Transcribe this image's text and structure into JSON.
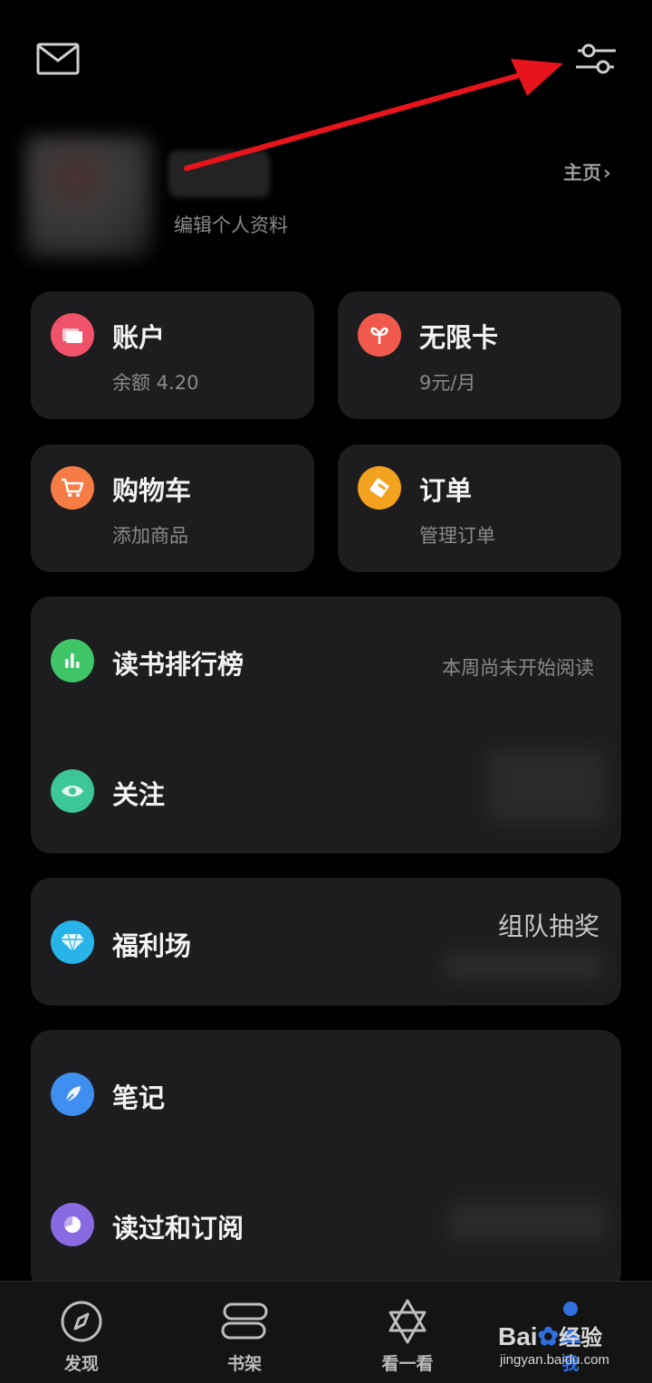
{
  "header": {
    "mail_icon": "mail-icon",
    "settings_icon": "sliders-icon"
  },
  "profile": {
    "edit_label": "编辑个人资料",
    "home_label": "主页",
    "home_arrow": "›"
  },
  "tiles": [
    {
      "title": "账户",
      "subtitle": "余额 4.20",
      "icon": "wallet-icon",
      "color": "#f0526a"
    },
    {
      "title": "无限卡",
      "subtitle": "9元/月",
      "icon": "card-icon",
      "color": "#f05a4c"
    },
    {
      "title": "购物车",
      "subtitle": "添加商品",
      "icon": "cart-icon",
      "color": "#f57d45"
    },
    {
      "title": "订单",
      "subtitle": "管理订单",
      "icon": "ticket-icon",
      "color": "#f3a21f"
    }
  ],
  "list1": {
    "ranking_title": "读书排行榜",
    "ranking_status": "本周尚未开始阅读",
    "follow_title": "关注"
  },
  "list2": {
    "welfare_title": "福利场",
    "welfare_status": "组队抽奖"
  },
  "list3": {
    "notes_title": "笔记",
    "read_title": "读过和订阅"
  },
  "bottom_nav": [
    {
      "label": "发现",
      "icon": "compass-icon"
    },
    {
      "label": "书架",
      "icon": "bookshelf-icon"
    },
    {
      "label": "看一看",
      "icon": "star-of-david-icon"
    },
    {
      "label": "我",
      "icon": "profile-icon"
    }
  ],
  "watermark": {
    "brand": "Bai",
    "brand2": "经验",
    "url": "jingyan.baidu.com"
  },
  "colors": {
    "background": "#000000",
    "card": "#1d1d1f",
    "accent_arrow": "#e8141b",
    "ranking_icon": "#3fc568",
    "follow_icon": "#3ec796",
    "welfare_icon": "#28b4e8",
    "notes_icon": "#3e8ff0",
    "read_icon": "#8a6ae3"
  }
}
